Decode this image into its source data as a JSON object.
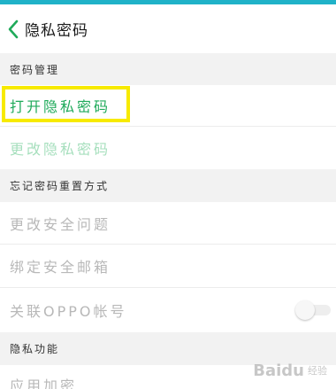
{
  "colors": {
    "accent": "#20b2c8",
    "green": "#1faa5a",
    "green_disabled": "#a6dfbd",
    "text_disabled": "#b8b8b8",
    "highlight": "#f7ea00"
  },
  "nav": {
    "title": "隐私密码",
    "back_icon": "chevron-left-icon"
  },
  "sections": {
    "password_management": {
      "header": "密码管理",
      "open_private_password": "打开隐私密码",
      "change_private_password": "更改隐私密码"
    },
    "reset_method": {
      "header": "忘记密码重置方式",
      "change_security_question": "更改安全问题",
      "bind_security_email": "绑定安全邮箱",
      "link_oppo_account": "关联OPPO帐号",
      "link_oppo_toggle_on": false
    },
    "privacy_features": {
      "header": "隐私功能",
      "app_encryption": "应用加密"
    }
  },
  "watermark": {
    "brand": "Baidu",
    "sub": "经验"
  }
}
